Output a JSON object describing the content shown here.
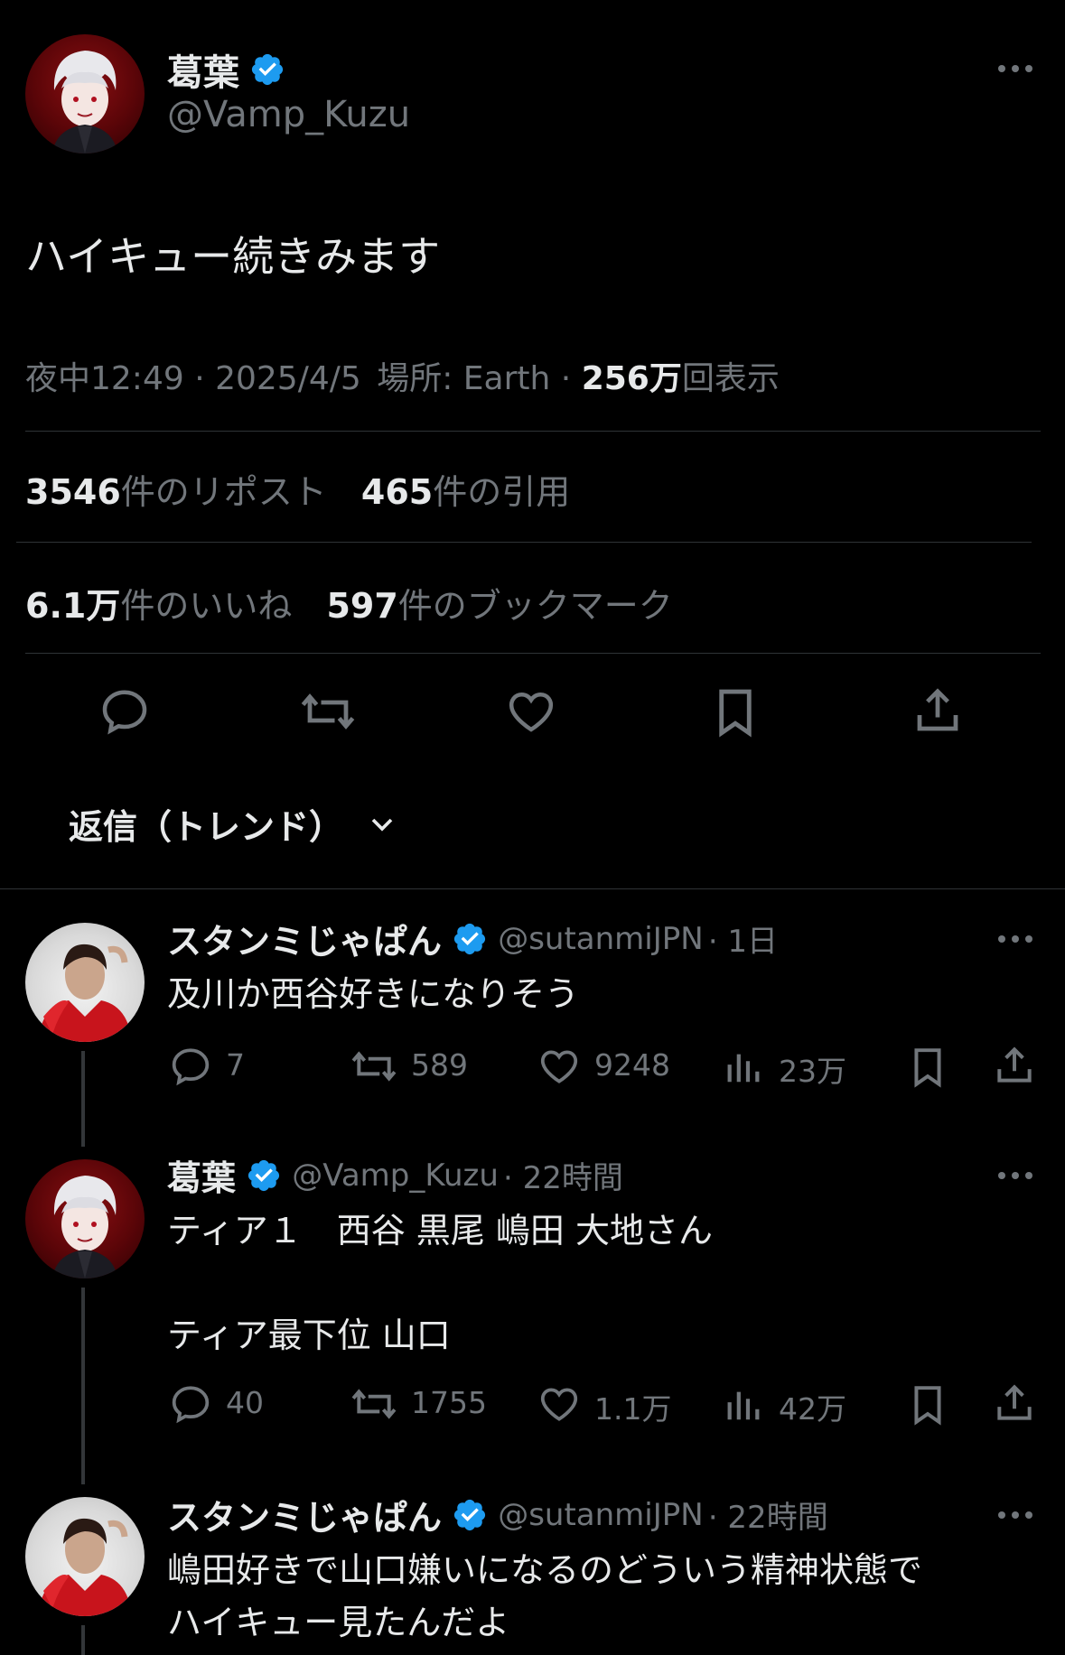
{
  "tweet": {
    "author_name": "葛葉",
    "author_handle": "@Vamp_Kuzu",
    "text": "ハイキュー続きみます",
    "time": "夜中12:49",
    "sep1": " · ",
    "date": "2025/4/5",
    "location": "場所: Earth",
    "sep2": " · ",
    "views_count": "256万",
    "views_label": "回表示",
    "reposts_count": "3546",
    "reposts_label": "件のリポスト",
    "quotes_count": "465",
    "quotes_label": "件の引用",
    "likes_count": "6.1万",
    "likes_label": "件のいいね",
    "bookmarks_count": "597",
    "bookmarks_label": "件のブックマーク"
  },
  "replies_filter": {
    "label": "返信（トレンド）"
  },
  "replies": [
    {
      "name": "スタンミじゃぱん",
      "handle": "@sutanmiJPN",
      "time": "· 1日",
      "text_lines": [
        "及川か西谷好きになりそう"
      ],
      "replies": "7",
      "reposts": "589",
      "likes": "9248",
      "views": "23万"
    },
    {
      "name": "葛葉",
      "handle": "@Vamp_Kuzu",
      "time": "· 22時間",
      "text_lines": [
        "ティア１　西谷 黒尾 嶋田 大地さん",
        "",
        "ティア最下位 山口"
      ],
      "replies": "40",
      "reposts": "1755",
      "likes": "1.1万",
      "views": "42万"
    },
    {
      "name": "スタンミじゃぱん",
      "handle": "@sutanmiJPN",
      "time": "· 22時間",
      "text_lines": [
        "嶋田好きで山口嫌いになるのどういう精神状態で",
        "ハイキュー見たんだよ"
      ]
    }
  ],
  "colors": {
    "background": "#000000",
    "text": "#e7e9ea",
    "muted": "#71767b",
    "verified": "#1d9bf0",
    "divider": "#2f3336"
  }
}
